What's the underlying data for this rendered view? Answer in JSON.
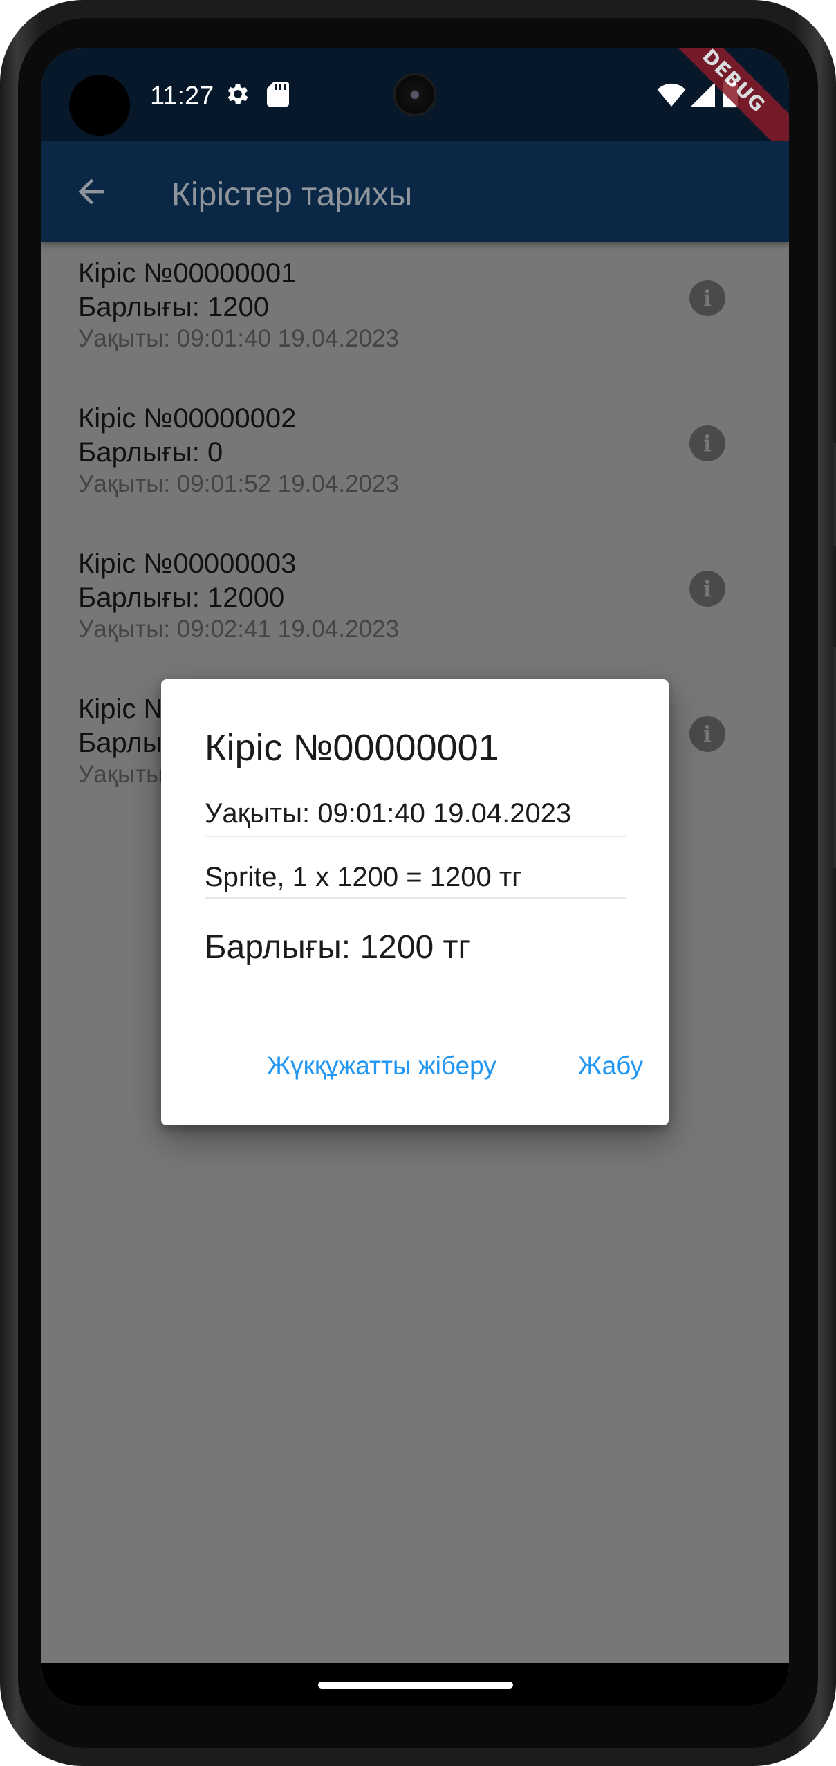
{
  "status_bar": {
    "time": "11:27",
    "icons": [
      "settings-gear-icon",
      "sd-card-icon",
      "wifi-icon",
      "signal-icon",
      "battery-icon"
    ],
    "debug_banner": "DEBUG"
  },
  "app_bar": {
    "title": "Кірістер тарихы",
    "back_icon": "arrow-back-icon",
    "color": "#0a2845"
  },
  "list": {
    "items": [
      {
        "title": "Кіріс №00000001",
        "total": "Барлығы: 1200",
        "time": "Уақыты: 09:01:40 19.04.2023"
      },
      {
        "title": "Кіріс №00000002",
        "total": "Барлығы: 0",
        "time": "Уақыты: 09:01:52 19.04.2023"
      },
      {
        "title": "Кіріс №00000003",
        "total": "Барлығы: 12000",
        "time": "Уақыты: 09:02:41 19.04.2023"
      },
      {
        "title": "Кіріс №",
        "total": "Барлы",
        "time": "Уақыты"
      }
    ],
    "info_icon": "info-icon"
  },
  "dialog": {
    "title": "Кіріс №00000001",
    "time": "Уақыты: 09:01:40 19.04.2023",
    "line_item": "Sprite, 1 x 1200 = 1200 тг",
    "total": "Барлығы: 1200 тг",
    "send_button": "Жүкқұжатты жіберу",
    "close_button": "Жабу",
    "accent_color": "#2196f3"
  }
}
